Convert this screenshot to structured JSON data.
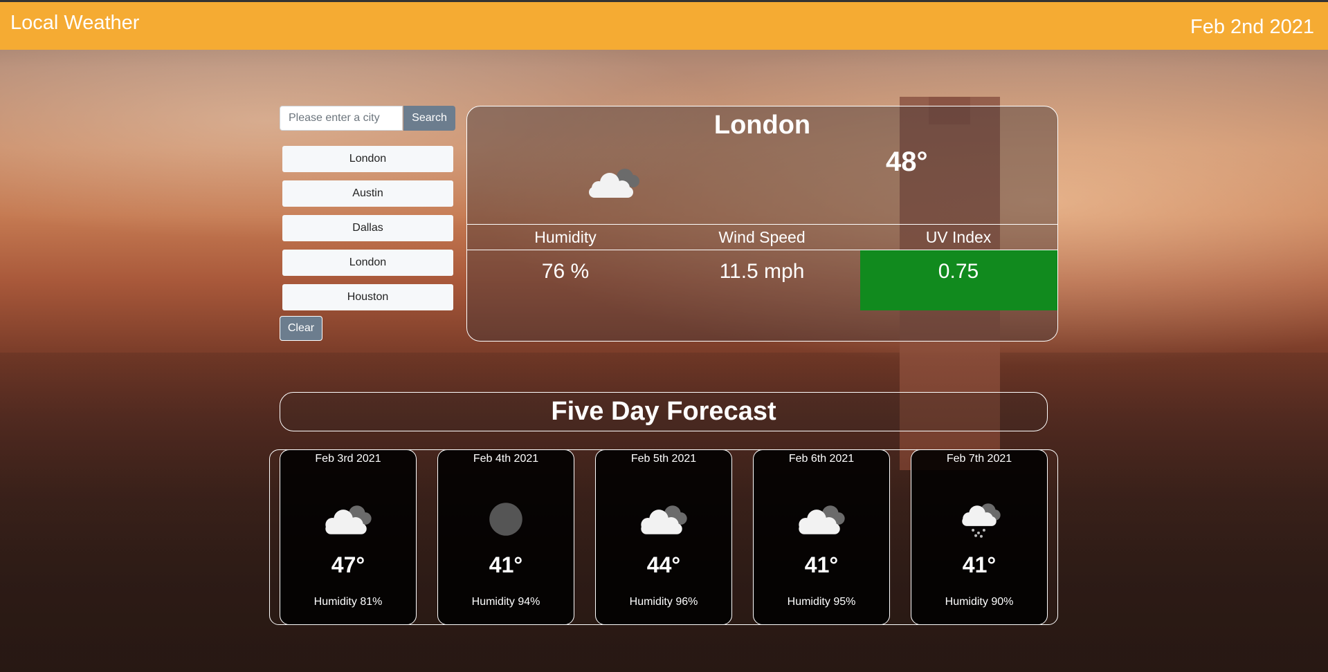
{
  "header": {
    "title": "Local Weather",
    "date": "Feb 2nd 2021"
  },
  "colors": {
    "header_bg": "#f5ab33",
    "button_bg": "#6c7d8e",
    "uv_good": "#118a1e"
  },
  "search": {
    "placeholder": "Please enter a city",
    "button_label": "Search"
  },
  "history": {
    "items": [
      "London",
      "Austin",
      "Dallas",
      "London",
      "Houston"
    ],
    "clear_label": "Clear"
  },
  "current": {
    "city": "London",
    "icon": "cloudy-icon",
    "temperature": "48°",
    "humidity_label": "Humidity",
    "humidity": "76 %",
    "wind_label": "Wind Speed",
    "wind": "11.5 mph",
    "uv_label": "UV Index",
    "uv": "0.75"
  },
  "forecast": {
    "title": "Five Day Forecast",
    "days": [
      {
        "date": "Feb 3rd 2021",
        "icon": "cloudy-icon",
        "temp": "47°",
        "humidity": "Humidity 81%"
      },
      {
        "date": "Feb 4th 2021",
        "icon": "clear-night-icon",
        "temp": "41°",
        "humidity": "Humidity 94%"
      },
      {
        "date": "Feb 5th 2021",
        "icon": "cloudy-icon",
        "temp": "44°",
        "humidity": "Humidity 96%"
      },
      {
        "date": "Feb 6th 2021",
        "icon": "cloudy-icon",
        "temp": "41°",
        "humidity": "Humidity 95%"
      },
      {
        "date": "Feb 7th 2021",
        "icon": "rain-icon",
        "temp": "41°",
        "humidity": "Humidity 90%"
      }
    ]
  }
}
